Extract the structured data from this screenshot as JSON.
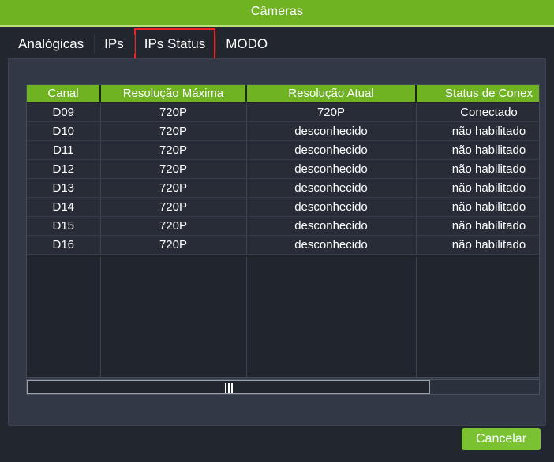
{
  "window": {
    "title": "Câmeras"
  },
  "tabs": [
    {
      "label": "Analógicas",
      "selected": false,
      "highlighted": false
    },
    {
      "label": "IPs",
      "selected": false,
      "highlighted": false
    },
    {
      "label": "IPs Status",
      "selected": true,
      "highlighted": true
    },
    {
      "label": "MODO",
      "selected": false,
      "highlighted": false
    }
  ],
  "table": {
    "columns": [
      "Canal",
      "Resolução Máxima",
      "Resolução Atual",
      "Status de Conex"
    ],
    "rows": [
      {
        "canal": "D09",
        "max": "720P",
        "atual": "720P",
        "status": "Conectado"
      },
      {
        "canal": "D10",
        "max": "720P",
        "atual": "desconhecido",
        "status": "não habilitado"
      },
      {
        "canal": "D11",
        "max": "720P",
        "atual": "desconhecido",
        "status": "não habilitado"
      },
      {
        "canal": "D12",
        "max": "720P",
        "atual": "desconhecido",
        "status": "não habilitado"
      },
      {
        "canal": "D13",
        "max": "720P",
        "atual": "desconhecido",
        "status": "não habilitado"
      },
      {
        "canal": "D14",
        "max": "720P",
        "atual": "desconhecido",
        "status": "não habilitado"
      },
      {
        "canal": "D15",
        "max": "720P",
        "atual": "desconhecido",
        "status": "não habilitado"
      },
      {
        "canal": "D16",
        "max": "720P",
        "atual": "desconhecido",
        "status": "não habilitado"
      }
    ]
  },
  "scrollbar": {
    "orientation": "horizontal",
    "grip_icon": "scroll-grip-icon"
  },
  "footer": {
    "cancel_label": "Cancelar"
  },
  "colors": {
    "accent_green": "#6fb322",
    "button_green": "#7ac232",
    "highlight_red": "#e8262a",
    "panel_bg": "#323845",
    "table_bg": "#1e222b",
    "row_bg": "#272c37",
    "window_bg": "#22262f",
    "text": "#ffffff"
  }
}
